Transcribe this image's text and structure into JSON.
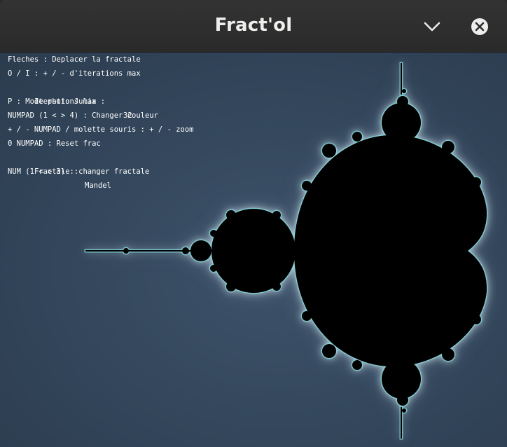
{
  "window": {
    "title": "Fract'ol",
    "controls": {
      "minimize_icon": "chevron-down-icon",
      "close_icon": "close-icon"
    }
  },
  "help": {
    "arrows": "Fleches : Deplacer la fractale",
    "iterations_keys": "O / I : + / - d'iterations max",
    "iterations_label": "Iterations max :",
    "iterations_value": "32",
    "photo_mode": "P : Mode photo Julia",
    "color_keys": "NUMPAD (1 < > 4) : Changer couleur",
    "zoom_keys": "+ / - NUMPAD / molette souris : + / - zoom",
    "reset": "0 NUMPAD : Reset frac",
    "fractal_label": "Fractale :",
    "fractal_value": "Mandel",
    "fractal_keys": "NUM (1 < > 3) : changer fractale"
  },
  "colors": {
    "background": "#34485d",
    "set": "#000000",
    "glow": "#e6f2f4",
    "titlebar": "#2d2d2d"
  }
}
